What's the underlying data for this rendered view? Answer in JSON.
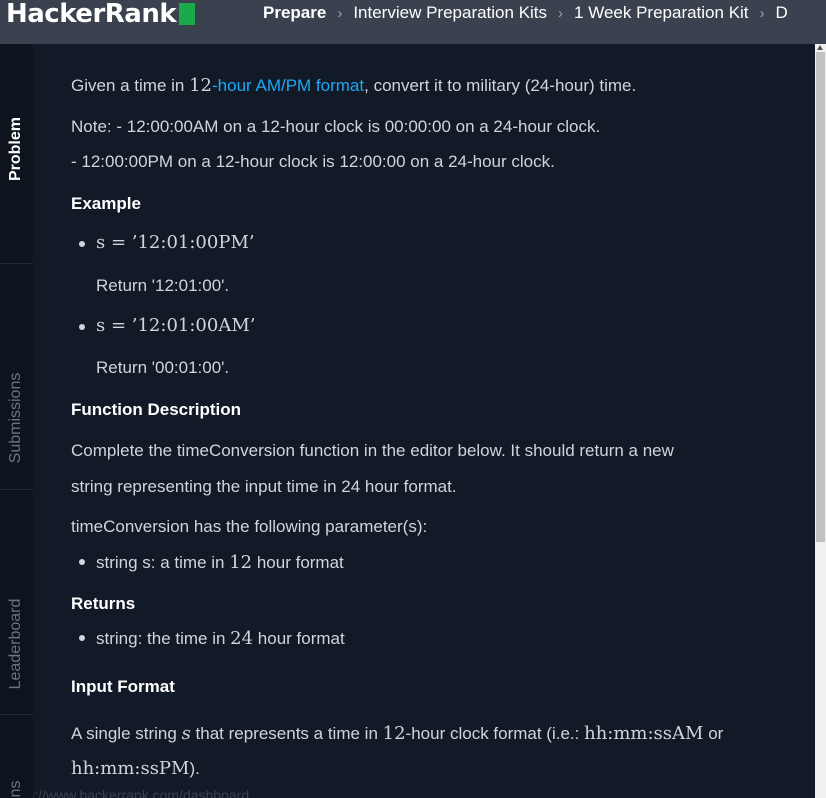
{
  "nav": {
    "logo": "HackerRank",
    "breadcrumbs": [
      "Prepare",
      "Interview Preparation Kits",
      "1 Week Preparation Kit",
      "D"
    ]
  },
  "tabs": [
    "Problem",
    "Submissions",
    "Leaderboard",
    "ns"
  ],
  "problem": {
    "intro_pre": "Given a time in ",
    "intro_num": "12",
    "intro_link": "-hour AM/PM format",
    "intro_post": ", convert it to military (24-hour) time.",
    "note1": "Note: - 12:00:00AM on a 12-hour clock is 00:00:00 on a 24-hour clock.",
    "note2": "- 12:00:00PM on a 12-hour clock is 12:00:00 on a 24-hour clock.",
    "example_heading": "Example",
    "ex1_s": "s = ’12:01:00PM’",
    "ex1_ret": "Return '12:01:00'.",
    "ex2_s": "s = ’12:01:00AM’",
    "ex2_ret": "Return '00:01:00'.",
    "fd_heading": "Function Description",
    "fd_line1": "Complete the timeConversion function in the editor below. It should return a new",
    "fd_line2": "string representing the input time in 24 hour format.",
    "params_intro": "timeConversion has the following parameter(s):",
    "param_pre": "string s: a time in ",
    "param_num": "12",
    "param_post": " hour format",
    "returns_heading": "Returns",
    "ret_pre": "string: the time in ",
    "ret_num": "24",
    "ret_post": " hour format",
    "input_heading": "Input Format",
    "input_pre": "A single string ",
    "input_var": "s",
    "input_mid": " that represents a time in ",
    "input_num": "12",
    "input_mid2": "-hour clock format (i.e.: ",
    "input_fmt1": "hh:mm:ssAM",
    "input_or": " or",
    "input_fmt2": "hh:mm:ssPM",
    "input_end": ").",
    "status_url": "https://www.hackerrank.com/dashboard"
  }
}
